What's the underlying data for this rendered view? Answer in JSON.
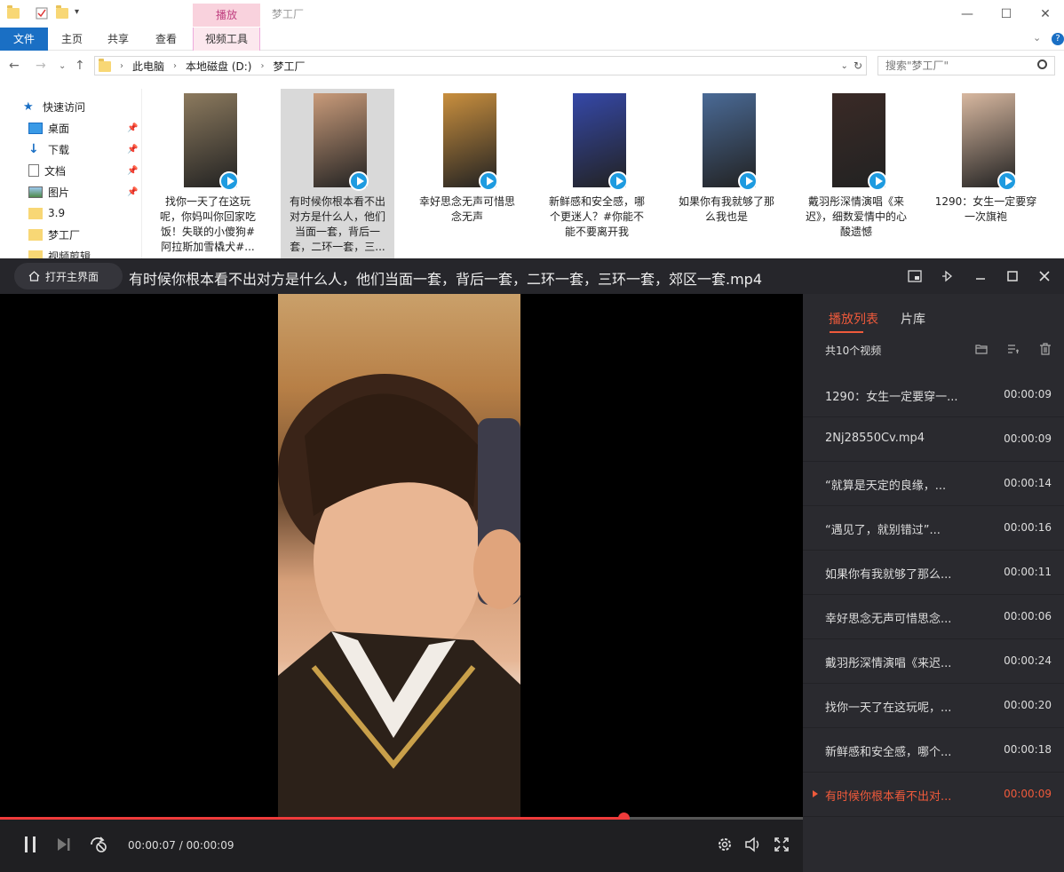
{
  "explorer": {
    "context_tab": "播放",
    "window_title": "梦工厂",
    "ribbon_tabs": [
      "文件",
      "主页",
      "共享",
      "查看",
      "视频工具"
    ],
    "breadcrumb": [
      "此电脑",
      "本地磁盘 (D:)",
      "梦工厂"
    ],
    "search_placeholder": "搜索\"梦工厂\"",
    "sidebar": [
      {
        "label": "快速访问",
        "icon": "star-icon"
      },
      {
        "label": "桌面",
        "icon": "desktop-icon",
        "pinned": true
      },
      {
        "label": "下载",
        "icon": "download-icon",
        "pinned": true
      },
      {
        "label": "文档",
        "icon": "document-icon",
        "pinned": true
      },
      {
        "label": "图片",
        "icon": "picture-icon",
        "pinned": true
      },
      {
        "label": "3.9",
        "icon": "folder-icon"
      },
      {
        "label": "梦工厂",
        "icon": "folder-icon"
      },
      {
        "label": "视频剪辑",
        "icon": "folder-icon"
      }
    ],
    "files": [
      {
        "label": "找你一天了在这玩呢，你妈叫你回家吃饭！失联的小傻狗#阿拉斯加雪橇犬#...",
        "selected": false,
        "thumb_color": "#8c7a5e"
      },
      {
        "label": "有时候你根本看不出对方是什么人，他们当面一套，背后一套，二环一套，三...",
        "selected": true,
        "thumb_color": "#c99b7a"
      },
      {
        "label": "幸好思念无声可惜思念无声",
        "selected": false,
        "thumb_color": "#c98f3e"
      },
      {
        "label": "新鲜感和安全感，哪个更迷人？#你能不能不要离开我",
        "selected": false,
        "thumb_color": "#3548a8"
      },
      {
        "label": "如果你有我就够了那么我也是",
        "selected": false,
        "thumb_color": "#4a6a96"
      },
      {
        "label": "戴羽彤深情演唱《来迟》，细数爱情中的心酸遗憾",
        "selected": false,
        "thumb_color": "#3a2a26"
      },
      {
        "label": "1290：女生一定要穿一次旗袍",
        "selected": false,
        "thumb_color": "#d8b8a0"
      }
    ]
  },
  "player": {
    "home_label": "打开主界面",
    "title": "有时候你根本看不出对方是什么人，他们当面一套，背后一套，二环一套，三环一套，郊区一套.mp4",
    "time_display": "00:00:07 / 00:00:09",
    "progress_fraction": 0.776,
    "playlist_tabs": [
      "播放列表",
      "片库"
    ],
    "playlist_count": "共10个视频",
    "playlist": [
      {
        "name": "1290：女生一定要穿一...",
        "duration": "00:00:09",
        "current": false
      },
      {
        "name": "2Nj28550Cv.mp4",
        "duration": "00:00:09",
        "current": false
      },
      {
        "name": "“就算是天定的良缘，...",
        "duration": "00:00:14",
        "current": false
      },
      {
        "name": "“遇见了，就别错过”...",
        "duration": "00:00:16",
        "current": false
      },
      {
        "name": "如果你有我就够了那么...",
        "duration": "00:00:11",
        "current": false
      },
      {
        "name": "幸好思念无声可惜思念...",
        "duration": "00:00:06",
        "current": false
      },
      {
        "name": "戴羽彤深情演唱《来迟...",
        "duration": "00:00:24",
        "current": false
      },
      {
        "name": "找你一天了在这玩呢，...",
        "duration": "00:00:20",
        "current": false
      },
      {
        "name": "新鲜感和安全感，哪个...",
        "duration": "00:00:18",
        "current": false
      },
      {
        "name": "有时候你根本看不出对...",
        "duration": "00:00:09",
        "current": true
      }
    ],
    "colors": {
      "accent": "#ef5a3b",
      "seek": "#ef3b3b"
    }
  }
}
